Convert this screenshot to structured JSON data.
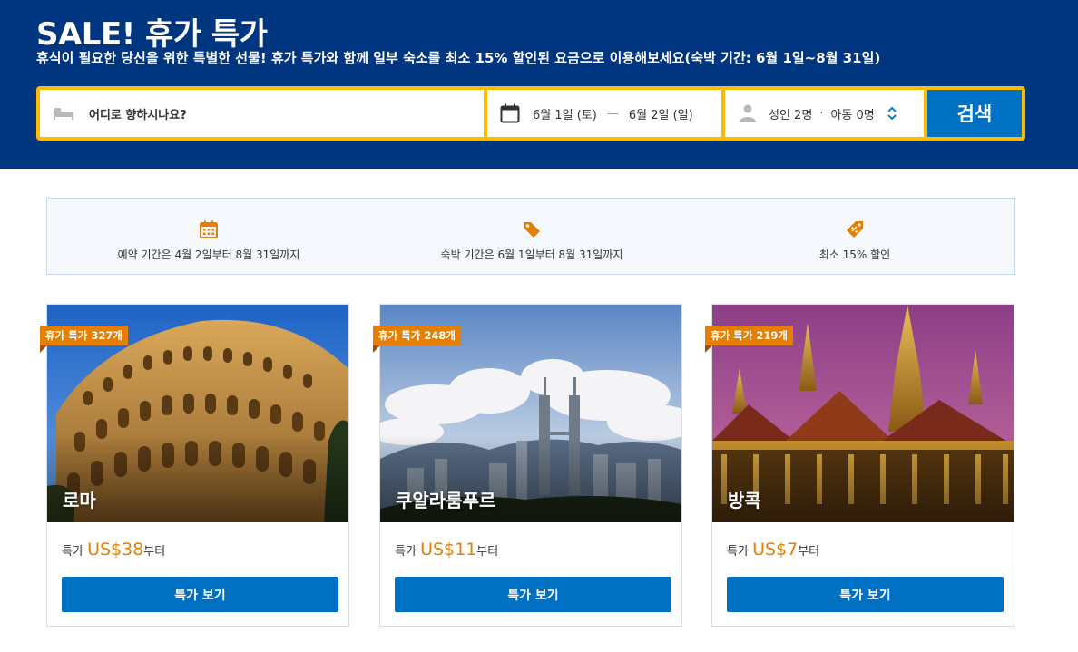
{
  "hero": {
    "title": "SALE! 휴가 특가",
    "subtitle": "휴식이 필요한 당신을 위한 특별한 선물! 휴가 특가와 함께 일부 숙소를 최소 15% 할인된 요금으로 이용해보세요(숙박 기간: 6월 1일~8월 31일)"
  },
  "search": {
    "destination_placeholder": "어디로 향하시나요?",
    "checkin": "6월 1일 (토)",
    "dash": "—",
    "checkout": "6월 2일 (일)",
    "adults": "성인 2명",
    "dot": "·",
    "children": "아동 0명",
    "button": "검색",
    "icons": {
      "destination": "bed-icon",
      "dates": "calendar-icon",
      "guests": "person-icon",
      "stepper": "chevron-updown-icon"
    }
  },
  "info": [
    {
      "icon": "calendar-icon",
      "label": "예약 기간은 4월 2일부터 8월 31일까지"
    },
    {
      "icon": "tag-icon",
      "label": "숙박 기간은 6월 1일부터 8월 31일까지"
    },
    {
      "icon": "discount-tag-icon",
      "label": "최소 15% 할인"
    }
  ],
  "cards": [
    {
      "badge": "휴가 특가 327개",
      "city": "로마",
      "price_prefix": "특가 ",
      "price": "US$38",
      "price_suffix": "부터",
      "button": "특가 보기"
    },
    {
      "badge": "휴가 특가 248개",
      "city": "쿠알라룸푸르",
      "price_prefix": "특가 ",
      "price": "US$11",
      "price_suffix": "부터",
      "button": "특가 보기"
    },
    {
      "badge": "휴가 특가 219개",
      "city": "방콕",
      "price_prefix": "특가 ",
      "price": "US$7",
      "price_suffix": "부터",
      "button": "특가 보기"
    }
  ],
  "colors": {
    "brand_blue": "#003580",
    "button_blue": "#0071c2",
    "search_yellow": "#febb02",
    "deal_orange": "#e67e00"
  }
}
